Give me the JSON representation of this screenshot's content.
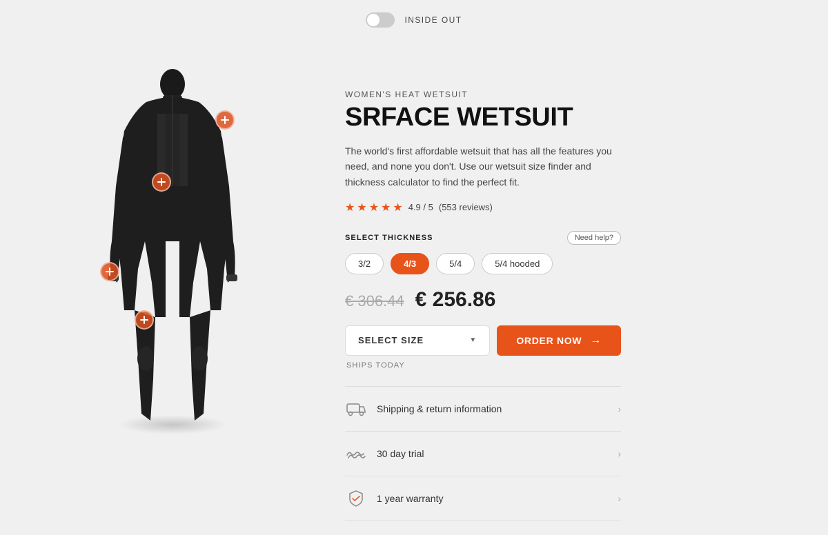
{
  "topbar": {
    "toggle_label": "INSIDE OUT"
  },
  "product": {
    "subtitle": "WOMEN'S HEAT WETSUIT",
    "title": "SRFACE WETSUIT",
    "description": "The world's first affordable wetsuit that has all the features you need, and none you don't. Use our wetsuit size finder and thickness calculator to find the perfect fit.",
    "rating_score": "4.9 / 5",
    "rating_reviews": "(553 reviews)",
    "thickness_label": "SELECT THICKNESS",
    "need_help_label": "Need help?",
    "thickness_options": [
      "3/2",
      "4/3",
      "5/4",
      "5/4 hooded"
    ],
    "active_thickness": "4/3",
    "price_original": "€ 306.44",
    "price_sale": "€ 256.86",
    "size_placeholder": "SELECT SIZE",
    "order_button": "ORDER NOW",
    "ships_today": "SHIPS TODAY"
  },
  "info_items": [
    {
      "label": "Shipping & return information",
      "icon": "truck"
    },
    {
      "label": "30 day trial",
      "icon": "wave"
    },
    {
      "label": "1 year warranty",
      "icon": "shield"
    }
  ],
  "colors": {
    "accent": "#e8531a",
    "background": "#f0f0f0"
  }
}
